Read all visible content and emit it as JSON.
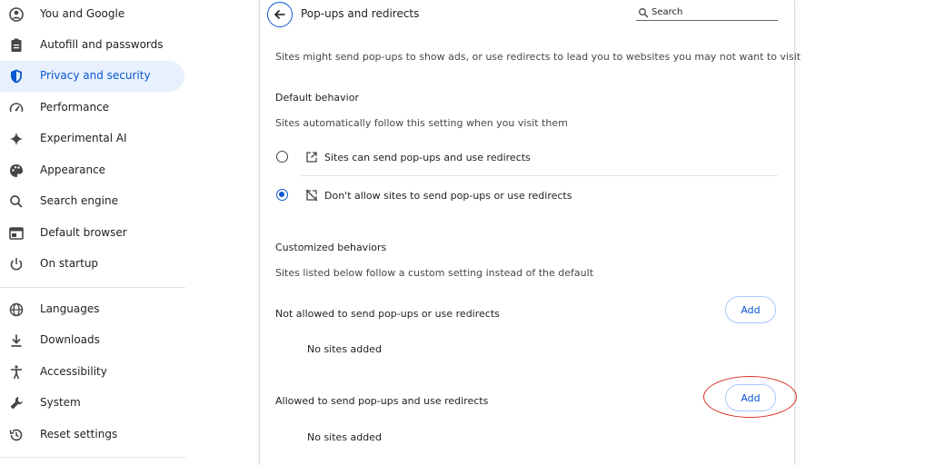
{
  "sidebar": {
    "items": [
      {
        "label": "You and Google",
        "icon": "google-icon"
      },
      {
        "label": "Autofill and passwords",
        "icon": "clipboard-icon"
      },
      {
        "label": "Privacy and security",
        "icon": "shield-icon",
        "active": true
      },
      {
        "label": "Performance",
        "icon": "speedometer-icon"
      },
      {
        "label": "Experimental AI",
        "icon": "sparkle-icon"
      },
      {
        "label": "Appearance",
        "icon": "palette-icon"
      },
      {
        "label": "Search engine",
        "icon": "search-icon"
      },
      {
        "label": "Default browser",
        "icon": "browser-window-icon"
      },
      {
        "label": "On startup",
        "icon": "power-icon"
      },
      {
        "label": "Languages",
        "icon": "globe-icon"
      },
      {
        "label": "Downloads",
        "icon": "download-icon"
      },
      {
        "label": "Accessibility",
        "icon": "accessibility-icon"
      },
      {
        "label": "System",
        "icon": "wrench-icon"
      },
      {
        "label": "Reset settings",
        "icon": "history-icon"
      }
    ]
  },
  "header": {
    "title": "Pop-ups and redirects",
    "search_placeholder": "Search"
  },
  "main": {
    "description": "Sites might send pop-ups to show ads, or use redirects to lead you to websites you may not want to visit",
    "default_behavior": {
      "heading": "Default behavior",
      "subtext": "Sites automatically follow this setting when you visit them",
      "options": [
        {
          "label": "Sites can send pop-ups and use redirects",
          "icon": "open-in-new-icon",
          "checked": false
        },
        {
          "label": "Don't allow sites to send pop-ups or use redirects",
          "icon": "blocked-popup-icon",
          "checked": true
        }
      ]
    },
    "customized": {
      "heading": "Customized behaviors",
      "subtext": "Sites listed below follow a custom setting instead of the default",
      "not_allowed": {
        "label": "Not allowed to send pop-ups or use redirects",
        "button": "Add",
        "empty": "No sites added"
      },
      "allowed": {
        "label": "Allowed to send pop-ups and use redirects",
        "button": "Add",
        "empty": "No sites added"
      }
    }
  },
  "colors": {
    "accent": "#0b57d0",
    "active_bg": "#e8f0fe",
    "highlight": "#d93025"
  }
}
